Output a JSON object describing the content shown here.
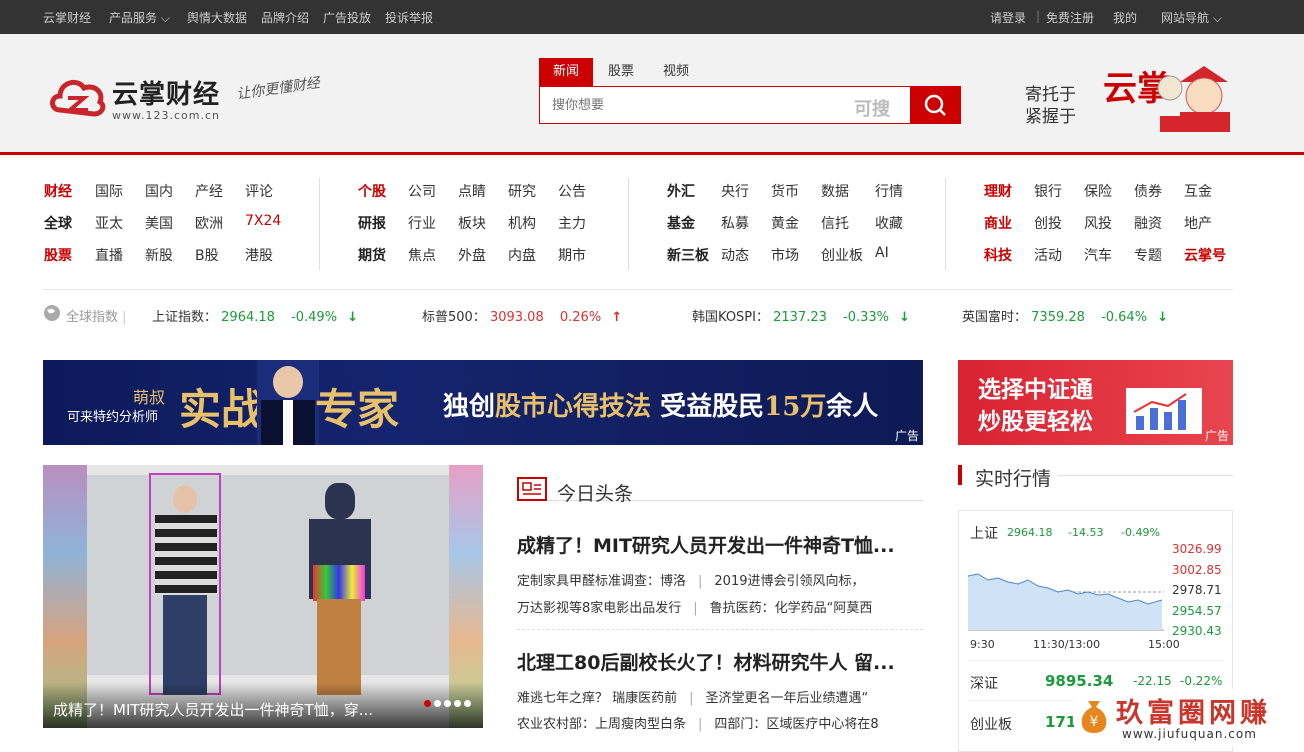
{
  "topbar": {
    "left": [
      "云掌财经",
      "产品服务",
      "舆情大数据",
      "品牌介绍",
      "广告投放",
      "投诉举报"
    ],
    "login": "请登录",
    "register": "免费注册",
    "mine": "我的",
    "sitenav": "网站导航"
  },
  "logo": {
    "name": "云掌财经",
    "url": "www.123.com.cn",
    "slogan": "让你更懂财经"
  },
  "search": {
    "tabs": [
      "新闻",
      "股票",
      "视频"
    ],
    "placeholder": "搜你想要",
    "brand": "可搜"
  },
  "promo": {
    "line1": "寄托于",
    "line2": "紧握于",
    "big": "云掌"
  },
  "nav": {
    "g1": [
      [
        "财经",
        "国际",
        "国内",
        "产经",
        "评论"
      ],
      [
        "全球",
        "亚太",
        "美国",
        "欧洲",
        "7X24"
      ],
      [
        "股票",
        "直播",
        "新股",
        "B股",
        "港股"
      ]
    ],
    "g2": [
      [
        "个股",
        "公司",
        "点睛",
        "研究",
        "公告"
      ],
      [
        "研报",
        "行业",
        "板块",
        "机构",
        "主力"
      ],
      [
        "期货",
        "焦点",
        "外盘",
        "内盘",
        "期市"
      ]
    ],
    "g3": [
      [
        "外汇",
        "央行",
        "货币",
        "数据",
        "行情"
      ],
      [
        "基金",
        "私募",
        "黄金",
        "信托",
        "收藏"
      ],
      [
        "新三板",
        "动态",
        "市场",
        "创业板",
        "AI"
      ]
    ],
    "g4": [
      [
        "理财",
        "银行",
        "保险",
        "债券",
        "互金"
      ],
      [
        "商业",
        "创投",
        "风投",
        "融资",
        "地产"
      ],
      [
        "科技",
        "活动",
        "汽车",
        "专题",
        "云掌号"
      ]
    ]
  },
  "indices": {
    "label": "全球指数",
    "items": [
      {
        "name": "上证指数：",
        "value": "2964.18",
        "change": "-0.49%"
      },
      {
        "name": "标普500：",
        "value": "3093.08",
        "change": "0.26%"
      },
      {
        "name": "韩国KOSPI：",
        "value": "2137.23",
        "change": "-0.33%"
      },
      {
        "name": "英国富时：",
        "value": "7359.28",
        "change": "-0.64%"
      }
    ]
  },
  "banner1": {
    "name": "萌叔",
    "desc": "可来特约分析师",
    "big1": "实战",
    "big2": "专家",
    "slogan_a": "独创",
    "slogan_b": "股市心得技法",
    "slogan_c": "受益股民",
    "slogan_d": "15万",
    "slogan_e": "余人",
    "ad": "广告"
  },
  "banner2": {
    "line1": "选择中证通",
    "line2": "炒股更轻松",
    "ad": "广告"
  },
  "slider": {
    "caption": "成精了！MIT研究人员开发出一件神奇T恤，穿..."
  },
  "headlines": {
    "title": "今日头条",
    "items": [
      {
        "title": "成精了！MIT研究人员开发出一件神奇T恤...",
        "sub": [
          [
            "定制家具甲醛标准调查：博洛",
            "2019进博会引领风向标，"
          ],
          [
            "万达影视等8家电影出品发行",
            "鲁抗医药：化学药品“阿莫西"
          ]
        ]
      },
      {
        "title": "北理工80后副校长火了！材料研究牛人 留...",
        "sub": [
          [
            "难逃七年之痒？ 瑞康医药前",
            "圣济堂更名一年后业绩遭遇“"
          ],
          [
            "农业农村部：上周瘦肉型白条",
            "四部门：区域医疗中心将在8"
          ]
        ]
      }
    ]
  },
  "market": {
    "title": "实时行情",
    "sh": {
      "name": "上证",
      "value": "2964.18",
      "change": "-14.53",
      "pct": "-0.49%"
    },
    "yticks": [
      "3026.99",
      "3002.85",
      "2978.71",
      "2954.57",
      "2930.43"
    ],
    "xticks": [
      "9:30",
      "11:30/13:00",
      "15:00"
    ],
    "sz": {
      "name": "深证",
      "value": "9895.34",
      "change": "-22.15",
      "pct": "-0.22%"
    },
    "cy": {
      "name": "创业板",
      "value": "171"
    }
  },
  "watermark": {
    "title": "玖富圈网赚",
    "url": "www.jiufuquan.com"
  }
}
